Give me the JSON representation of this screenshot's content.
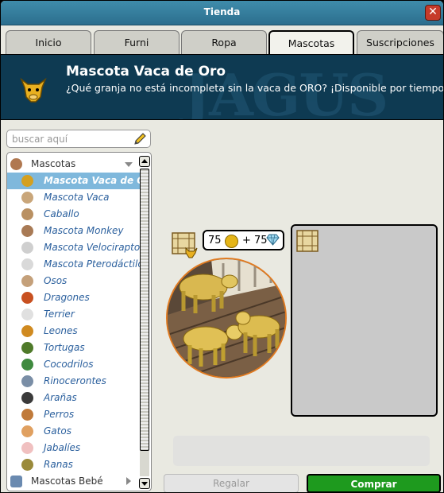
{
  "window": {
    "title": "Tienda",
    "close_symbol": "✕"
  },
  "tabs": [
    {
      "label": "Inicio"
    },
    {
      "label": "Furni"
    },
    {
      "label": "Ropa"
    },
    {
      "label": "Mascotas",
      "active": true
    },
    {
      "label": "Suscripciones"
    }
  ],
  "banner": {
    "title": "Mascota Vaca de Oro",
    "description": "¿Qué granja no está incompleta sin la vaca de ORO? ¡Disponible por tiempo limitado!",
    "watermark": "JAGUS"
  },
  "search": {
    "placeholder": "buscar aquí"
  },
  "catalog": {
    "category": "Mascotas",
    "items": [
      {
        "label": "Mascota Vaca de Oro",
        "selected": true,
        "color": "#d4a020"
      },
      {
        "label": "Mascota Vaca",
        "color": "#c9a67a"
      },
      {
        "label": "Caballo",
        "color": "#b99062"
      },
      {
        "label": "Mascota Monkey",
        "color": "#a87a55"
      },
      {
        "label": "Mascota Velociraptor",
        "color": "#cfcfcf"
      },
      {
        "label": "Mascota Pterodáctilo",
        "color": "#d9d9d9"
      },
      {
        "label": "Osos",
        "color": "#c4a07a"
      },
      {
        "label": "Dragones",
        "color": "#c85020"
      },
      {
        "label": "Terrier",
        "color": "#e0e0e0"
      },
      {
        "label": "Leones",
        "color": "#d08a20"
      },
      {
        "label": "Tortugas",
        "color": "#4f7a2a"
      },
      {
        "label": "Cocodrilos",
        "color": "#3f8a3f"
      },
      {
        "label": "Rinocerontes",
        "color": "#7a8ea6"
      },
      {
        "label": "Arañas",
        "color": "#3a3a3a"
      },
      {
        "label": "Perros",
        "color": "#c07a3a"
      },
      {
        "label": "Gatos",
        "color": "#e0a060"
      },
      {
        "label": "Jabalíes",
        "color": "#f0c0c0"
      },
      {
        "label": "Ranas",
        "color": "#9a8a3a"
      }
    ],
    "next_category": "Mascotas Bebé"
  },
  "product": {
    "price_credits": "75",
    "price_diamonds": "+ 75"
  },
  "actions": {
    "gift_label": "Regalar",
    "buy_label": "Comprar"
  },
  "colors": {
    "accent": "#2c6f8e",
    "buy": "#1e9a1e",
    "selected_row": "#7fb8dc"
  }
}
